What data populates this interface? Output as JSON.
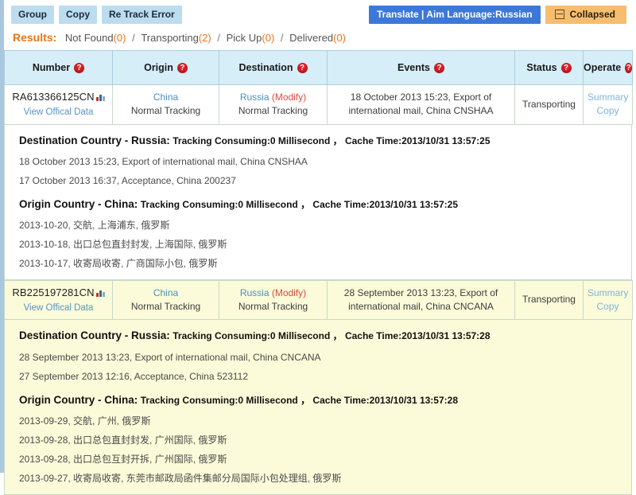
{
  "toolbar": {
    "buttons": [
      {
        "label": "Group",
        "name": "group-button"
      },
      {
        "label": "Copy",
        "name": "copy-button"
      },
      {
        "label": "Re Track Error",
        "name": "re-track-error-button"
      }
    ],
    "translate_label": "Translate | Aim Language:Russian",
    "collapsed_label": "Collapsed"
  },
  "results": {
    "label": "Results:",
    "items": [
      {
        "name": "Not Found",
        "count": "(0)"
      },
      {
        "name": "Transporting",
        "count": "(2)"
      },
      {
        "name": "Pick Up",
        "count": "(0)"
      },
      {
        "name": "Delivered",
        "count": "(0)"
      }
    ],
    "separator": "/"
  },
  "table": {
    "headers": [
      "Number",
      "Origin",
      "Destination",
      "Events",
      "Status",
      "Operate"
    ],
    "rows": [
      {
        "number": "RA613366125CN",
        "number_sub": "View Offical Data",
        "origin_country": "China",
        "origin_mode": "Normal Tracking",
        "destination_country": "Russia",
        "destination_modify": "(Modify)",
        "destination_mode": "Normal Tracking",
        "event": "18 October 2013 15:23, Export of international mail, China CNSHAA",
        "status": "Transporting",
        "op_summary": "Summary",
        "op_copy": "Copy"
      },
      {
        "number": "RB225197281CN",
        "number_sub": "View Offical Data",
        "origin_country": "China",
        "origin_mode": "Normal Tracking",
        "destination_country": "Russia",
        "destination_modify": "(Modify)",
        "destination_mode": "Normal Tracking",
        "event": "28 September 2013 13:23, Export of international mail, China CNCANA",
        "status": "Transporting",
        "op_summary": "Summary",
        "op_copy": "Copy"
      }
    ]
  },
  "details": [
    {
      "destination": {
        "heading": "Destination Country - Russia:",
        "meta": "Tracking Consuming:0 Millisecond ， Cache Time:2013/10/31 13:57:25",
        "events": [
          "18 October 2013 15:23, Export of international mail, China CNSHAA",
          "17 October 2013 16:37, Acceptance, China 200237"
        ]
      },
      "origin": {
        "heading": "Origin Country - China:",
        "meta": "Tracking Consuming:0 Millisecond ， Cache Time:2013/10/31 13:57:25",
        "events": [
          "2013-10-20, 交航, 上海浦东, 俄罗斯",
          "2013-10-18, 出口总包直封封发, 上海国际, 俄罗斯",
          "2013-10-17, 收寄局收寄, 广商国际小包, 俄罗斯"
        ]
      }
    },
    {
      "destination": {
        "heading": "Destination Country - Russia:",
        "meta": "Tracking Consuming:0 Millisecond ， Cache Time:2013/10/31 13:57:28",
        "events": [
          "28 September 2013 13:23, Export of international mail, China CNCANA",
          "27 September 2013 12:16, Acceptance, China 523112"
        ]
      },
      "origin": {
        "heading": "Origin Country - China:",
        "meta": "Tracking Consuming:0 Millisecond ， Cache Time:2013/10/31 13:57:28",
        "events": [
          "2013-09-29, 交航, 广州, 俄罗斯",
          "2013-09-28, 出口总包直封封发, 广州国际, 俄罗斯",
          "2013-09-28, 出口总包互封开拆, 广州国际, 俄罗斯",
          "2013-09-27, 收寄局收寄, 东莞市邮政局函件集邮分局国际小包处理组, 俄罗斯"
        ]
      }
    }
  ],
  "icons": {
    "help": "?",
    "chart": "mini-bar-chart-icon",
    "collapse": "minus-box-icon"
  },
  "colors": {
    "accent_orange": "#e8761b",
    "translate_blue": "#3c78d8",
    "collapsed_orange": "#f7bd6e",
    "header_blue": "#d6eef8",
    "row_cream": "#fbfbd9",
    "help_red": "#d81f26",
    "link_blue": "#5a93c7"
  }
}
